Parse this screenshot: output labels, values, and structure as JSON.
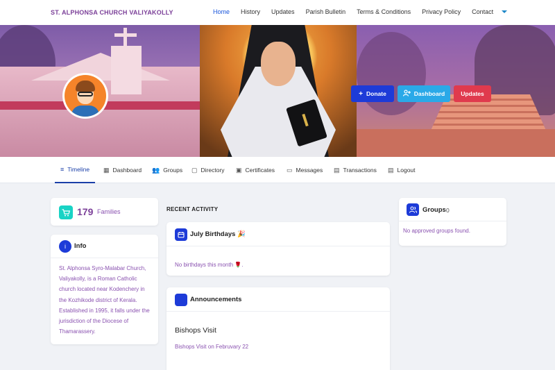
{
  "nav": {
    "brand": "ST. ALPHONSA CHURCH VALIYAKOLLY",
    "items": [
      "Home",
      "History",
      "Updates",
      "Parish Bulletin",
      "Terms & Conditions",
      "Privacy Policy",
      "Contact"
    ],
    "active": "Home"
  },
  "hero": {
    "buttons": {
      "donate": "Donate",
      "dashboard": "Dashboard",
      "updates": "Updates"
    }
  },
  "tabs": {
    "timeline": "Timeline",
    "dashboard": "Dashboard",
    "groups": "Groups",
    "directory": "Directory",
    "certificates": "Certificates",
    "messages": "Messages",
    "transactions": "Transactions",
    "logout": "Logout"
  },
  "families": {
    "count": "179",
    "label": "Families"
  },
  "info": {
    "title": "Info",
    "text": "St. Alphonsa Syro-Malabar Church, Valiyakolly, is a Roman Catholic church located near Kodenchery in the Kozhikode district of Kerala. Established in 1995, it falls under the jurisdiction of the Diocese of Thamarassery."
  },
  "recent_activity": {
    "heading": "RECENT ACTIVITY"
  },
  "birthdays": {
    "title": "July Birthdays 🎉",
    "empty": "No birthdays this month 🌹."
  },
  "announcements": {
    "title": "Announcements",
    "headline": "Bishops Visit",
    "text": "Bishops Visit on Februvary 22"
  },
  "groups": {
    "title": "Groups",
    "count": "0",
    "empty": "No approved groups found."
  },
  "colors": {
    "accent": "#1d3bd8",
    "brand": "#7b3f98",
    "donate": "#1d3bd8",
    "dashboard": "#2aa9e8",
    "updates": "#e03a4d"
  }
}
